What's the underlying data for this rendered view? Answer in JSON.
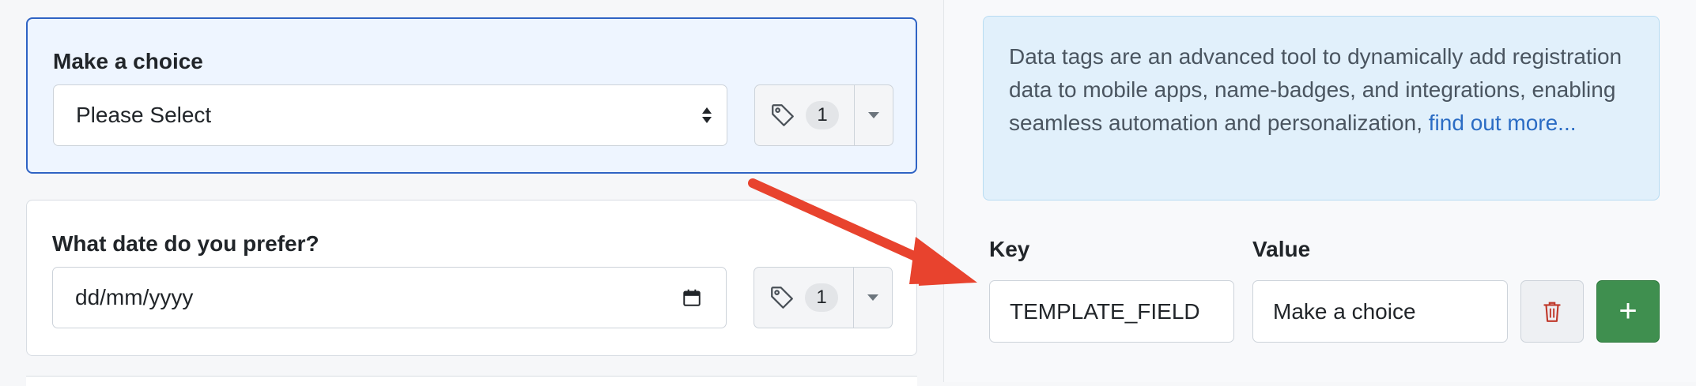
{
  "form": {
    "questions": [
      {
        "label": "Make a choice",
        "field_value": "Please Select",
        "tag_count": "1",
        "field_icon": "select-arrows-icon"
      },
      {
        "label": "What date do you prefer?",
        "field_value": "dd/mm/yyyy",
        "tag_count": "1",
        "field_icon": "calendar-icon"
      }
    ]
  },
  "panel": {
    "info_text": "Data tags are an advanced tool to dynamically add registration data to mobile apps, name-badges, and integrations, enabling seamless automation and personalization, ",
    "info_link": "find out more...",
    "key_label": "Key",
    "value_label": "Value",
    "key_value": "TEMPLATE_FIELD",
    "value_value": "Make a choice",
    "add_label": "+"
  },
  "colors": {
    "selected_border": "#2f63c4",
    "info_bg": "#e1f0fb",
    "link": "#2b6cc4",
    "add_button": "#3f8f4f",
    "delete_icon": "#c0392b",
    "annotation_arrow": "#e8432e"
  }
}
